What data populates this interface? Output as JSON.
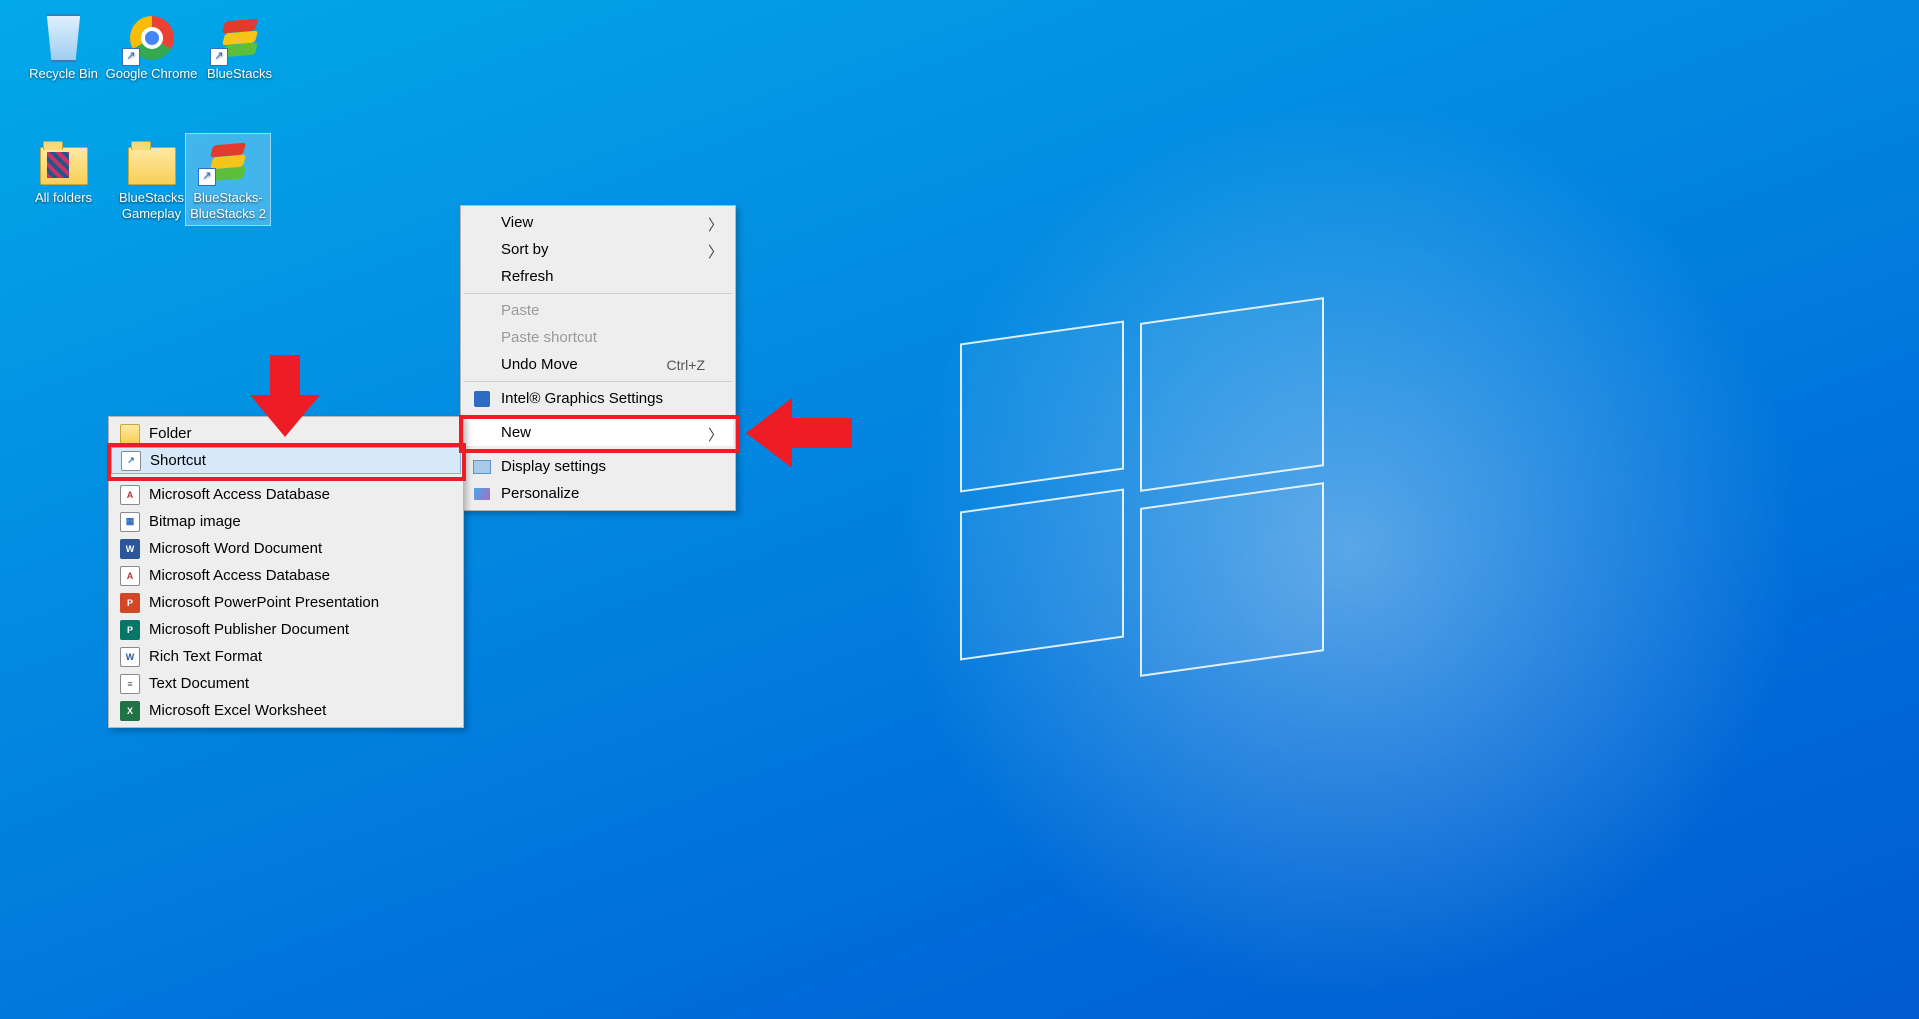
{
  "desktop_icons": [
    {
      "id": "recycle-bin",
      "label": "Recycle Bin"
    },
    {
      "id": "google-chrome",
      "label": "Google Chrome"
    },
    {
      "id": "bluestacks",
      "label": "BlueStacks"
    },
    {
      "id": "all-folders",
      "label": "All folders"
    },
    {
      "id": "bluestacks-gameplay",
      "label": "BlueStacks Gameplay"
    },
    {
      "id": "bluestacks-bluestacks2",
      "label": "BlueStacks-BlueStacks 2"
    }
  ],
  "context_menu": {
    "view": "View",
    "sort_by": "Sort by",
    "refresh": "Refresh",
    "paste": "Paste",
    "paste_shortcut": "Paste shortcut",
    "undo_move": "Undo Move",
    "undo_move_shortcut": "Ctrl+Z",
    "intel_graphics": "Intel® Graphics Settings",
    "new": "New",
    "display_settings": "Display settings",
    "personalize": "Personalize"
  },
  "new_submenu": {
    "folder": "Folder",
    "shortcut": "Shortcut",
    "access": "Microsoft Access Database",
    "bitmap": "Bitmap image",
    "word": "Microsoft Word Document",
    "access2": "Microsoft Access Database",
    "powerpoint": "Microsoft PowerPoint Presentation",
    "publisher": "Microsoft Publisher Document",
    "rtf": "Rich Text Format",
    "text": "Text Document",
    "excel": "Microsoft Excel Worksheet"
  },
  "icon_letters": {
    "shortcut_arrow": "↗",
    "access": "A",
    "bitmap": "▦",
    "word": "W",
    "ppt": "P",
    "pub": "P",
    "rtf": "W",
    "txt": "≡",
    "xls": "X"
  }
}
